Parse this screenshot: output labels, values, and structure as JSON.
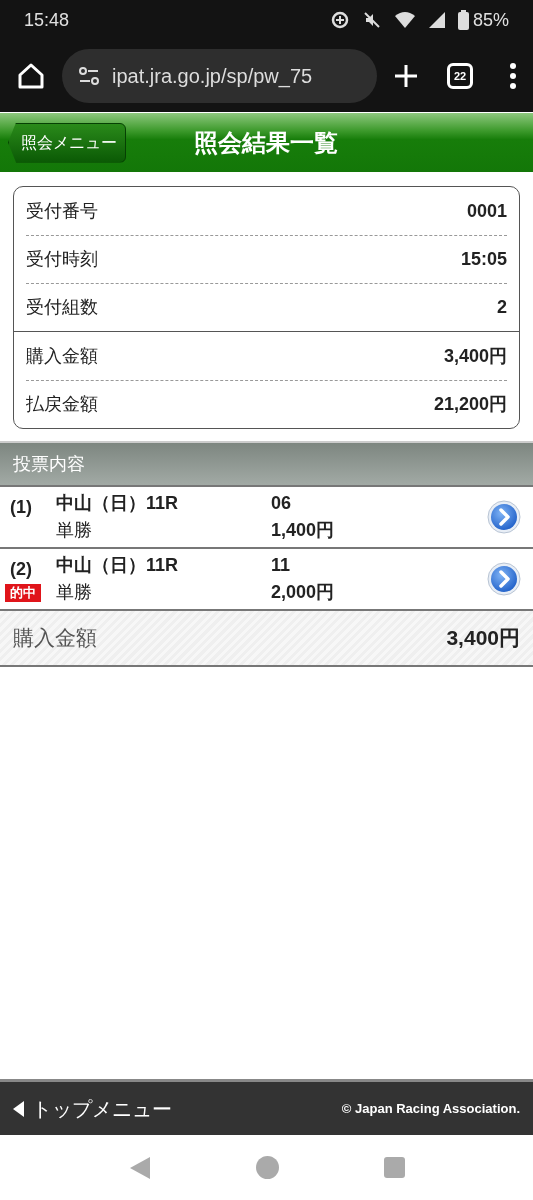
{
  "status_bar": {
    "time": "15:48",
    "battery": "85%"
  },
  "browser": {
    "url": "ipat.jra.go.jp/sp/pw_75",
    "tab_count": "22"
  },
  "header": {
    "back": "照会メニュー",
    "title": "照会結果一覧"
  },
  "summary": {
    "groups": [
      [
        {
          "label": "受付番号",
          "value": "0001"
        },
        {
          "label": "受付時刻",
          "value": "15:05"
        },
        {
          "label": "受付組数",
          "value": "2"
        }
      ],
      [
        {
          "label": "購入金額",
          "value": "3,400円"
        },
        {
          "label": "払戻金額",
          "value": "21,200円"
        }
      ]
    ]
  },
  "bets": {
    "title": "投票内容",
    "rows": [
      {
        "index": "(1)",
        "race": "中山（日）11R",
        "type": "単勝",
        "number": "06",
        "amount": "1,400円",
        "hit": false
      },
      {
        "index": "(2)",
        "race": "中山（日）11R",
        "type": "単勝",
        "number": "11",
        "amount": "2,000円",
        "hit": true,
        "hit_label": "的中"
      }
    ],
    "total_label": "購入金額",
    "total": "3,400円"
  },
  "footer": {
    "top_menu": "トップメニュー",
    "copyright": "© Japan Racing Association."
  }
}
